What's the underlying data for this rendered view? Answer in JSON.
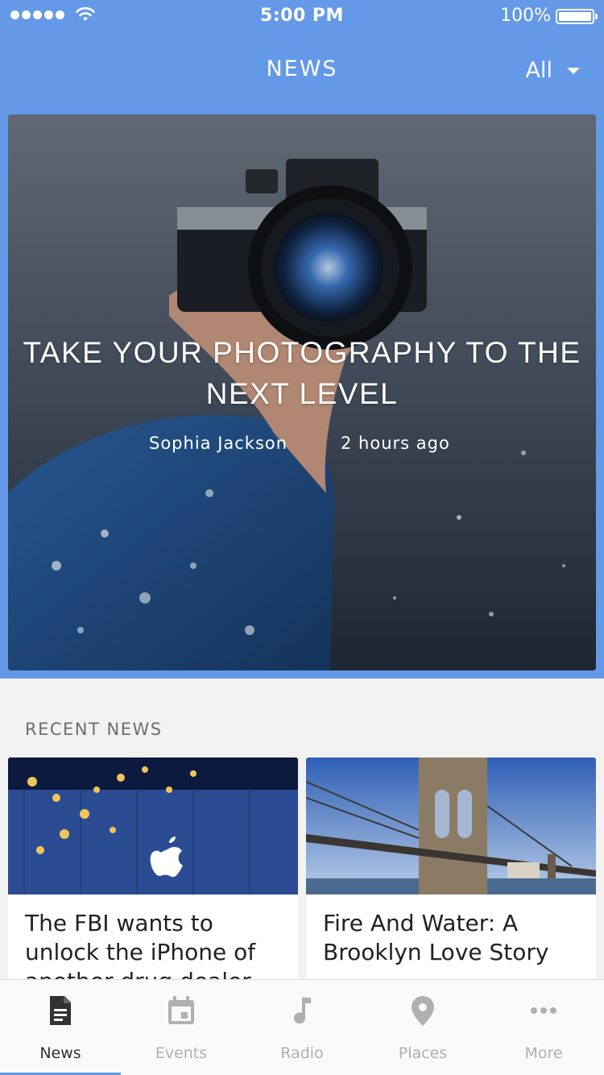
{
  "status_bar": {
    "time": "5:00 PM",
    "battery": "100%"
  },
  "nav": {
    "title": "NEWS",
    "filter": "All"
  },
  "featured": {
    "title": "TAKE YOUR PHOTOGRAPHY TO THE NEXT LEVEL",
    "author": "Sophia Jackson",
    "time": "2 hours ago"
  },
  "recent": {
    "label": "RECENT NEWS",
    "items": [
      {
        "title": "The FBI wants to unlock the iPhone of another drug dealer"
      },
      {
        "title": "Fire And Water: A Brooklyn Love Story"
      }
    ]
  },
  "tabs": [
    {
      "label": "News",
      "icon": "document-icon",
      "active": true
    },
    {
      "label": "Events",
      "icon": "calendar-icon",
      "active": false
    },
    {
      "label": "Radio",
      "icon": "music-note-icon",
      "active": false
    },
    {
      "label": "Places",
      "icon": "location-pin-icon",
      "active": false
    },
    {
      "label": "More",
      "icon": "more-dots-icon",
      "active": false
    }
  ],
  "colors": {
    "accent": "#6399e6",
    "tab_active": "#333333",
    "tab_inactive": "#b0b0b0"
  }
}
